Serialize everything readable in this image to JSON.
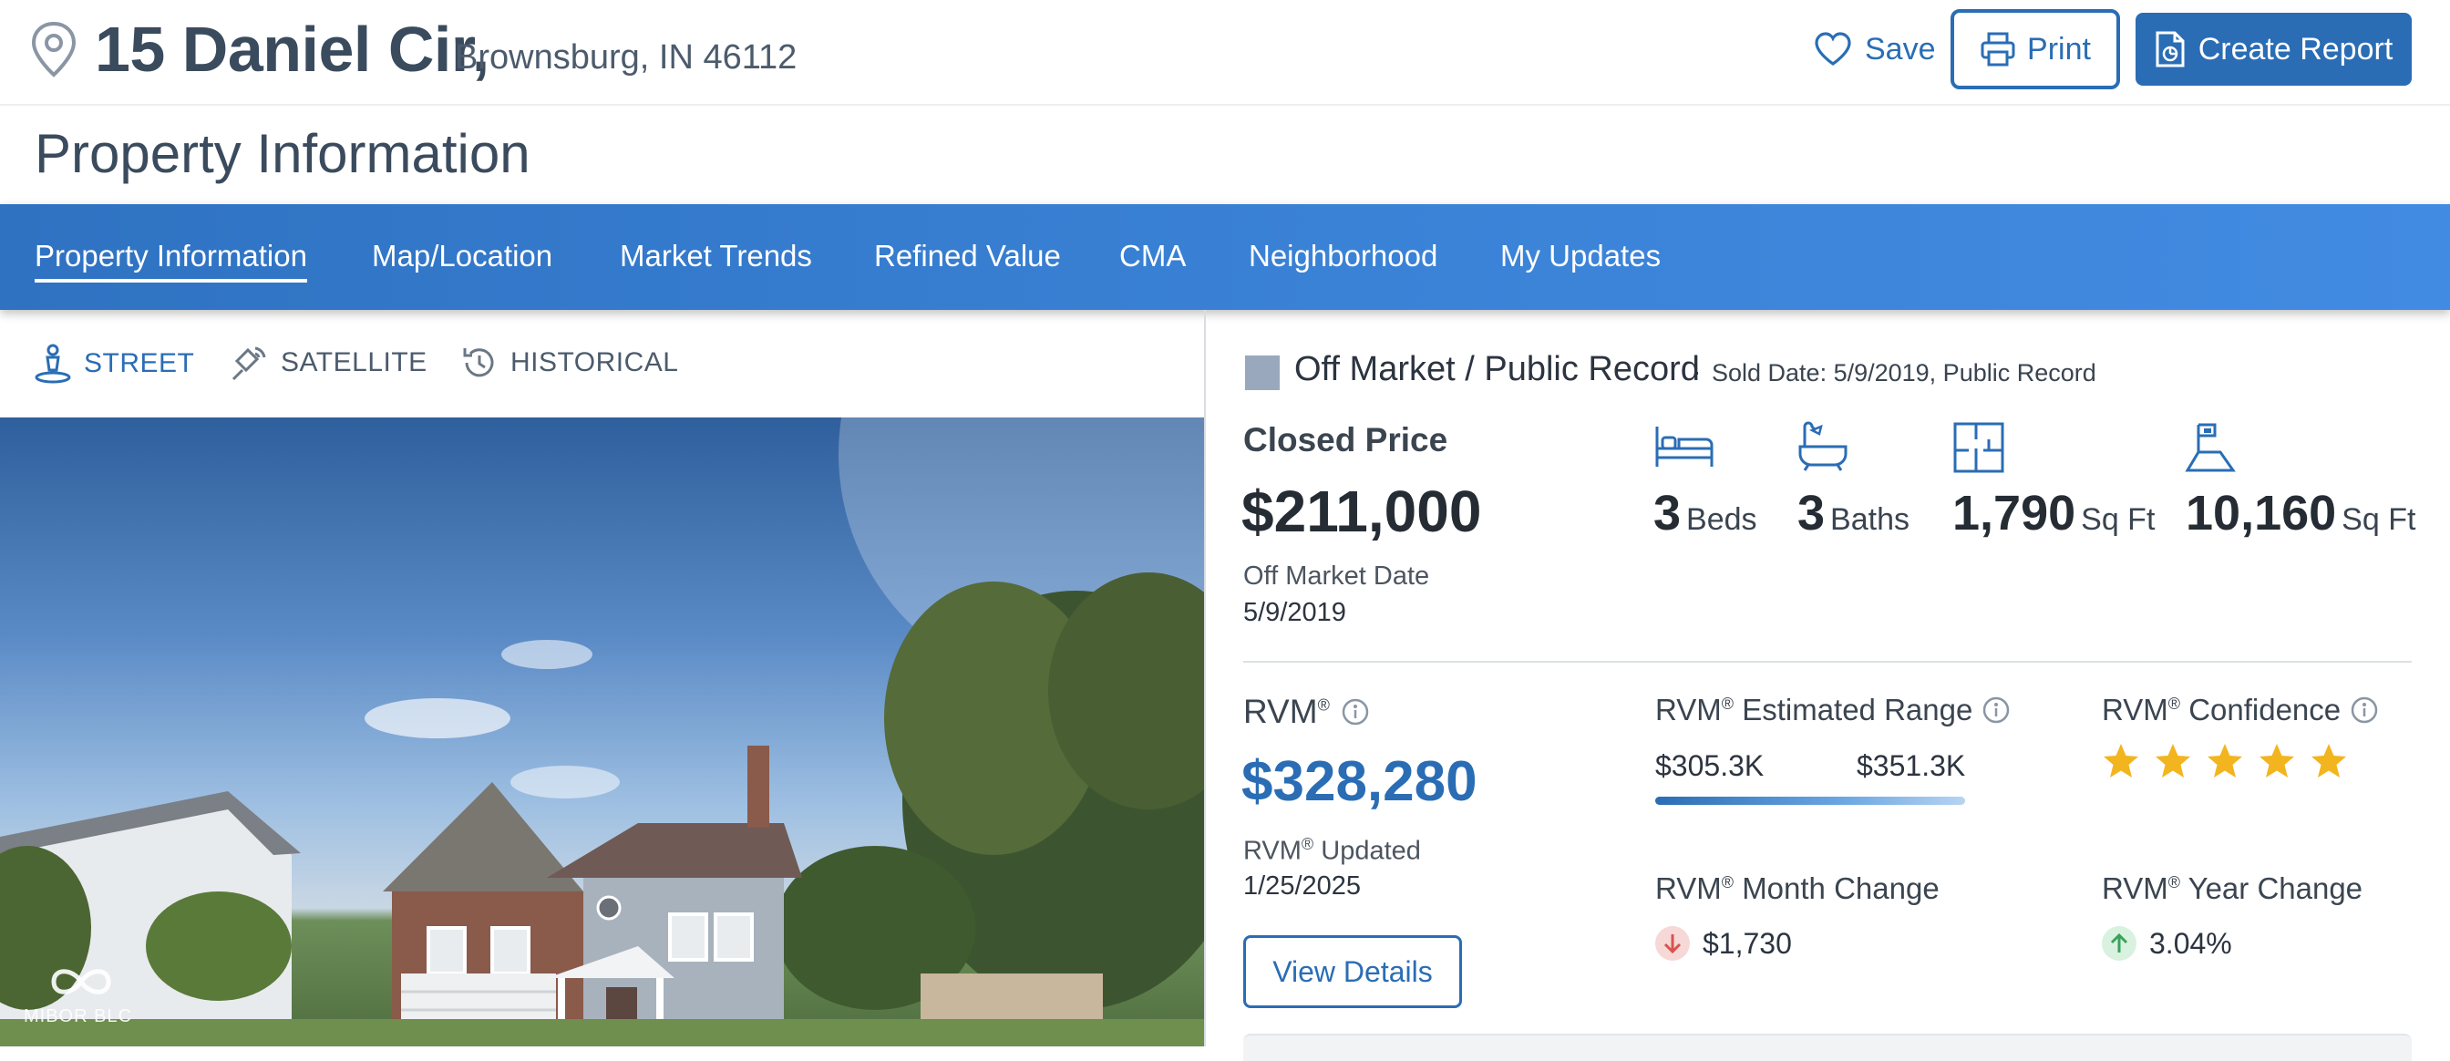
{
  "header": {
    "street": "15 Daniel Cir,",
    "city": "Brownsburg, IN 46112",
    "save_label": "Save",
    "print_label": "Print",
    "report_label": "Create Report"
  },
  "page_title": "Property Information",
  "nav": {
    "tabs": [
      {
        "label": "Property Information"
      },
      {
        "label": "Map/Location"
      },
      {
        "label": "Market Trends"
      },
      {
        "label": "Refined Value"
      },
      {
        "label": "CMA"
      },
      {
        "label": "Neighborhood"
      },
      {
        "label": "My Updates"
      }
    ],
    "active_index": 0
  },
  "photo_views": {
    "tabs": [
      {
        "label": "STREET",
        "icon": "street-view-icon"
      },
      {
        "label": "SATELLITE",
        "icon": "satellite-icon"
      },
      {
        "label": "HISTORICAL",
        "icon": "history-icon"
      }
    ],
    "active_index": 0,
    "watermark": "MIBOR BLC"
  },
  "status": {
    "label": "Off Market / Public Record",
    "separator": "·",
    "sold_date": "Sold Date: 5/9/2019, Public Record",
    "color": "#9aa8bd"
  },
  "closed": {
    "label": "Closed Price",
    "price": "$211,000",
    "off_market_label": "Off Market Date",
    "off_market_date": "5/9/2019"
  },
  "facts": [
    {
      "value": "3",
      "unit": "Beds",
      "icon": "bed-icon"
    },
    {
      "value": "3",
      "unit": "Baths",
      "icon": "bathtub-icon"
    },
    {
      "value": "1,790",
      "unit": "Sq Ft",
      "icon": "floorplan-icon"
    },
    {
      "value": "10,160",
      "unit": "Sq Ft",
      "icon": "lot-size-icon"
    }
  ],
  "rvm": {
    "label": "RVM",
    "reg": "®",
    "value": "$328,280",
    "updated_label": "Updated",
    "updated_date": "1/25/2025",
    "details_label": "View Details",
    "range_title": "Estimated Range",
    "range_low": "$305.3K",
    "range_high": "$351.3K",
    "confidence_title": "Confidence",
    "confidence_stars": 5,
    "month_title": "Month Change",
    "month_value": "$1,730",
    "month_direction": "down",
    "year_title": "Year Change",
    "year_value": "3.04%",
    "year_direction": "up"
  },
  "colors": {
    "accent": "#2a6db5",
    "nav_bg": "#3a82d6",
    "star": "#f2b51f",
    "down": "#d9534f",
    "up": "#3aa35b"
  }
}
